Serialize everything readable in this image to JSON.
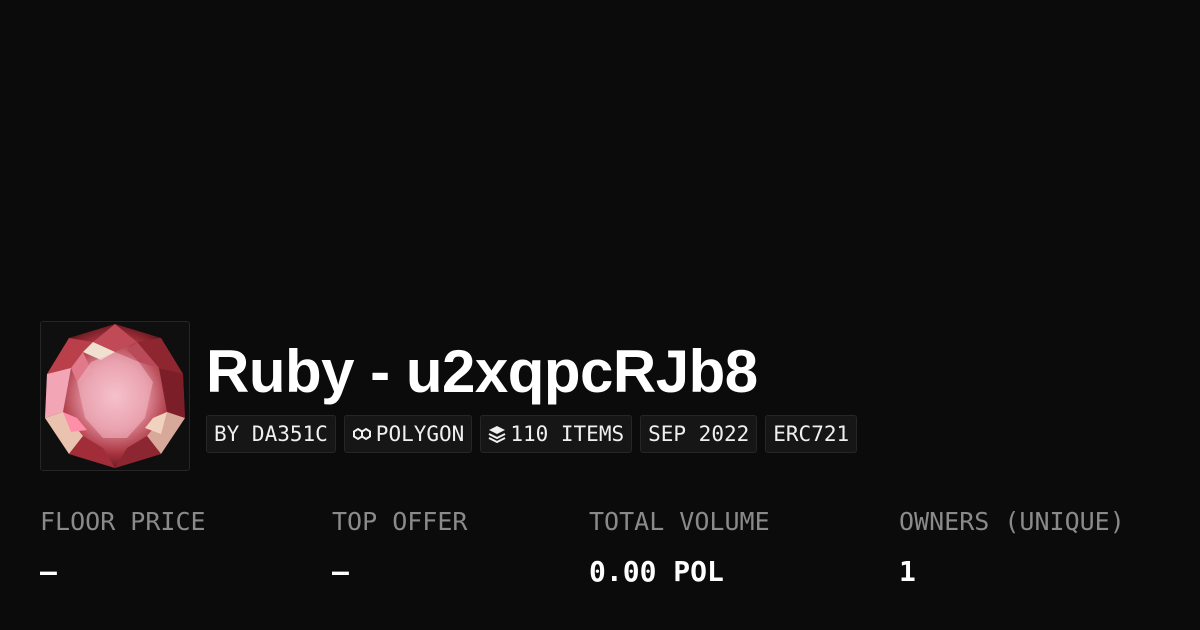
{
  "collection": {
    "title": "Ruby - u2xqpcRJb8",
    "avatar_icon": "ruby-gem-icon"
  },
  "chips": [
    {
      "label": "BY DA351C"
    },
    {
      "label": "POLYGON",
      "icon": "polygon-chain-icon"
    },
    {
      "label": "110 ITEMS",
      "icon": "layers-icon"
    },
    {
      "label": "SEP 2022"
    },
    {
      "label": "ERC721"
    }
  ],
  "stats": [
    {
      "label": "FLOOR PRICE",
      "value": "—"
    },
    {
      "label": "TOP OFFER",
      "value": "—"
    },
    {
      "label": "TOTAL VOLUME",
      "value": "0.00 POL"
    },
    {
      "label": "OWNERS (UNIQUE)",
      "value": "1"
    }
  ],
  "colors": {
    "background": "#0b0b0b",
    "chip_background": "#161616",
    "label_gray": "#8a8a8a",
    "ruby": "#c0434f"
  }
}
